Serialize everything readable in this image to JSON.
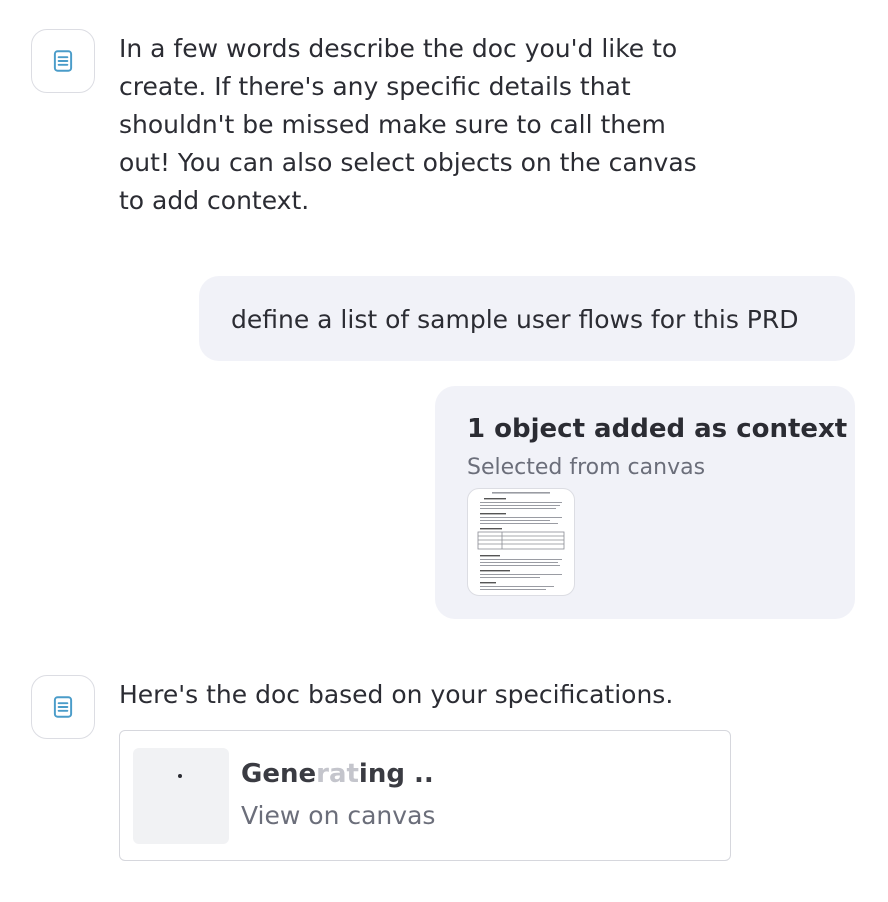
{
  "messages": {
    "assistant_intro": {
      "avatar_icon": "document-icon",
      "lines": [
        "In a few words describe the doc you'd like to",
        "create. If there's any specific details that",
        "shouldn't be missed make sure to call them",
        "out! You can also select objects on the canvas",
        "to add context."
      ]
    },
    "user_prompt": {
      "text": "define a list of sample user flows for this PRD"
    },
    "context_card": {
      "title": "1 object added as context",
      "subtitle": "Selected from canvas",
      "thumbnail_icon": "document-preview-thumbnail"
    },
    "assistant_reply": {
      "avatar_icon": "document-icon",
      "text": "Here's the doc based on your specifications.",
      "doc_card": {
        "status_visible": "Gene",
        "status_faded": "rat",
        "status_end": "ing ..",
        "link": "View on canvas"
      }
    }
  },
  "colors": {
    "icon_accent": "#4a9cc9",
    "bubble_bg": "#f1f2f8",
    "text": "#2b2c33",
    "muted": "#6b6e7a"
  }
}
